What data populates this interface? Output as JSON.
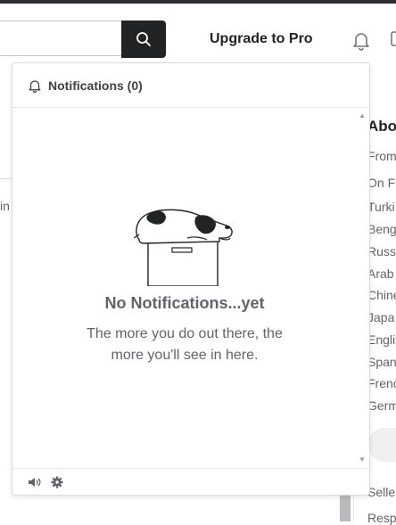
{
  "header": {
    "search": {
      "value": "",
      "placeholder": ""
    },
    "search_icon": "search-icon",
    "upgrade_label": "Upgrade to Pro",
    "bell_icon": "bell-icon",
    "mail_icon": "mail-icon"
  },
  "background": {
    "left_cut_text": "in",
    "right_column": {
      "title": "Abo",
      "items": [
        "From",
        "On F",
        "Turki",
        "Beng",
        "Russ",
        "Arab",
        "Chine",
        "Japa",
        "Englis",
        "Span",
        "Frenc",
        "Germ"
      ],
      "footer_items": [
        "Selle",
        "Resp"
      ]
    }
  },
  "notifications_panel": {
    "title": "Notifications (0)",
    "empty_title": "No Notifications...yet",
    "empty_subtitle": "The more you do out there, the more you'll see in here.",
    "footer_icons": [
      "sound-icon",
      "settings-icon"
    ]
  },
  "colors": {
    "dark": "#222325",
    "muted": "#62646a",
    "border": "#dadbdd"
  }
}
